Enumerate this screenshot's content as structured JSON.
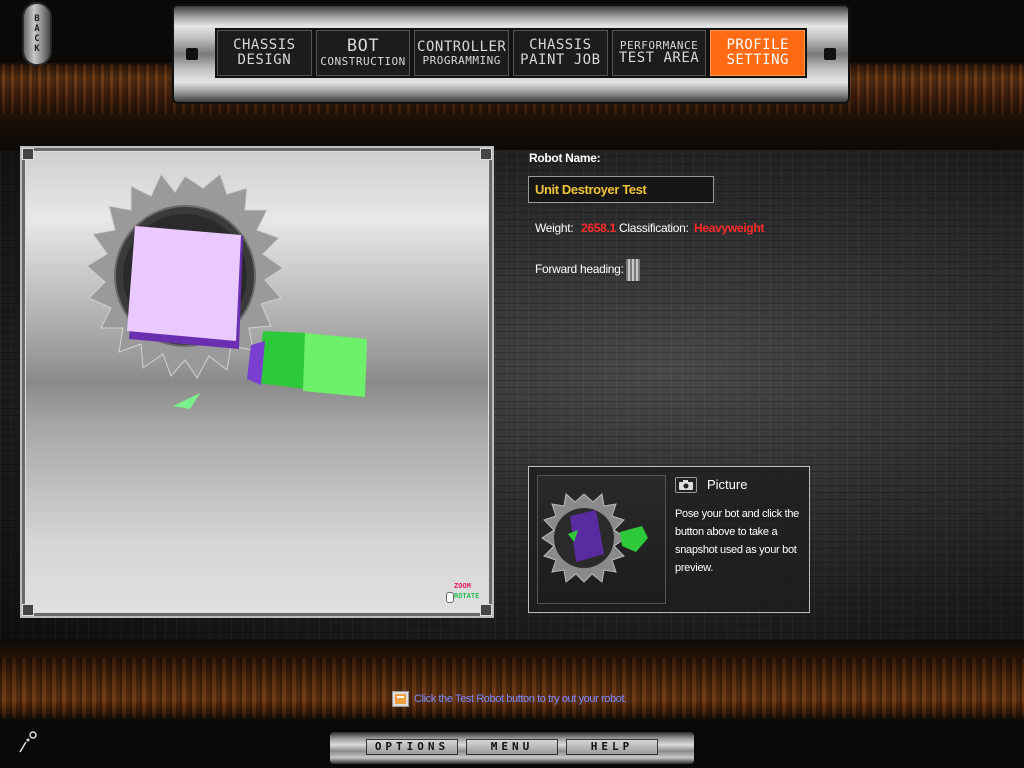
{
  "back": {
    "label": "BACK"
  },
  "nav": {
    "tabs": [
      {
        "line1": "Chassis",
        "line2": "Design",
        "active": false
      },
      {
        "line1": "Bot",
        "line2": "Construction",
        "active": false
      },
      {
        "line1": "Controller",
        "line2": "Programming",
        "active": false
      },
      {
        "line1": "Chassis",
        "line2": "Paint Job",
        "active": false
      },
      {
        "line1": "Performance",
        "line2": "Test Area",
        "active": false
      },
      {
        "line1": "Profile",
        "line2": "Setting",
        "active": true
      }
    ]
  },
  "viewport": {
    "zoom_label": "ZOOM",
    "rotate_label": "ROTATE"
  },
  "profile": {
    "robot_name_label": "Robot Name:",
    "robot_name_value": "Unit Destroyer Test",
    "weight_label": "Weight:",
    "weight_value": "2658.1",
    "classification_label": "Classification:",
    "classification_value": "Heavyweight",
    "forward_heading_label": "Forward heading:"
  },
  "picture": {
    "title": "Picture",
    "description": "Pose your bot and click the button above to take a snapshot used as your bot preview."
  },
  "hint": {
    "text": "Click the Test Robot button to try out your robot."
  },
  "bottom_menu": {
    "options": "OPTIONS",
    "menu": "MENU",
    "help": "HELP"
  },
  "colors": {
    "accent": "#ff6a12",
    "robot_name": "#f2c23a",
    "stat_value": "#ff2b2b",
    "hint_text": "#7a8cff"
  },
  "icons": {
    "camera": "camera-icon",
    "hint": "info-icon",
    "settings": "gear-icon"
  }
}
